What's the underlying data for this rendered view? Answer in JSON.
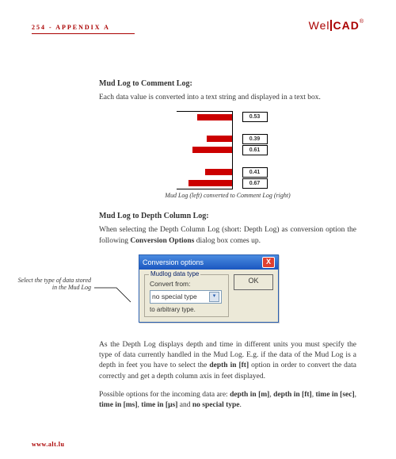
{
  "header": {
    "page_label": "254 - APPENDIX A",
    "brand_well": "Wel",
    "brand_cad": "CAD",
    "brand_reg": "®"
  },
  "sec1": {
    "title": "Mud Log to Comment Log:",
    "text": "Each data value is converted into a text string and displayed in a text box."
  },
  "mudlog": {
    "rows": [
      {
        "w": 44,
        "v": "0.53"
      },
      {
        "w": 0,
        "v": ""
      },
      {
        "w": 32,
        "v": "0.39"
      },
      {
        "w": 50,
        "v": "0.61"
      },
      {
        "w": 0,
        "v": ""
      },
      {
        "w": 34,
        "v": "0.41"
      },
      {
        "w": 55,
        "v": "0.67"
      }
    ],
    "caption": "Mud Log (left) converted to Comment Log (right)"
  },
  "sec2": {
    "title": "Mud Log to Depth Column Log:",
    "text_a": "When selecting the Depth Column Log (short: Depth Log) as conversion option the following ",
    "text_b": "Conversion Options",
    "text_c": " dialog box comes up."
  },
  "sidenote": "Select the type of data stored in the Mud Log",
  "dialog": {
    "title": "Conversion options",
    "group": "Mudlog data type",
    "convert_from": "Convert from:",
    "select_value": "no special type",
    "to_line": "to arbitrary type.",
    "ok": "OK",
    "close_glyph": "X"
  },
  "para3_a": "As the Depth Log displays depth and time in different units you must specify the type of data currently handled in the Mud Log. E.g. if the data of the Mud Log is a depth in feet you have to select the ",
  "para3_b": "depth in [ft]",
  "para3_c": " option in order to convert the data correctly and get a depth column axis in feet displayed.",
  "para4_a": "Possible options for the incoming data are: ",
  "para4_b": "depth in [m]",
  "para4_c": ", ",
  "para4_d": "depth in [ft]",
  "para4_e": ", ",
  "para4_f": "time in [sec]",
  "para4_g": ", ",
  "para4_h": "time in [ms]",
  "para4_i": ", ",
  "para4_j": "time in [µs]",
  "para4_k": " and ",
  "para4_l": "no special type",
  "para4_m": ".",
  "footer": "www.alt.lu"
}
